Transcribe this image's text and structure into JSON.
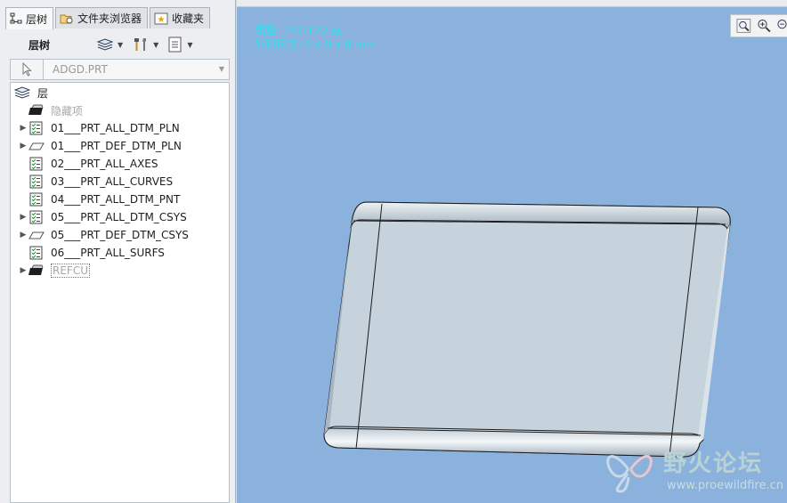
{
  "tabs": [
    {
      "label": "层树",
      "icon": "layer-tree-icon"
    },
    {
      "label": "文件夹浏览器",
      "icon": "folder-browser-icon"
    },
    {
      "label": "收藏夹",
      "icon": "favorites-icon"
    }
  ],
  "toolbar": {
    "title": "层树"
  },
  "filter": {
    "value": "ADGD.PRT"
  },
  "tree": {
    "root_label": "层",
    "items": [
      {
        "label": "隐藏项",
        "expandable": false,
        "icon": "hidden-layer-icon",
        "style": "dim"
      },
      {
        "label": "01___PRT_ALL_DTM_PLN",
        "expandable": true,
        "icon": "layer-checklist-icon",
        "style": "normal"
      },
      {
        "label": "01___PRT_DEF_DTM_PLN",
        "expandable": true,
        "icon": "datum-plane-icon",
        "style": "normal"
      },
      {
        "label": "02___PRT_ALL_AXES",
        "expandable": false,
        "icon": "layer-checklist-icon",
        "style": "normal"
      },
      {
        "label": "03___PRT_ALL_CURVES",
        "expandable": false,
        "icon": "layer-checklist-icon",
        "style": "normal"
      },
      {
        "label": "04___PRT_ALL_DTM_PNT",
        "expandable": false,
        "icon": "layer-checklist-icon",
        "style": "normal"
      },
      {
        "label": "05___PRT_ALL_DTM_CSYS",
        "expandable": true,
        "icon": "layer-checklist-icon",
        "style": "normal"
      },
      {
        "label": "05___PRT_DEF_DTM_CSYS",
        "expandable": true,
        "icon": "datum-plane-icon",
        "style": "normal"
      },
      {
        "label": "06___PRT_ALL_SURFS",
        "expandable": false,
        "icon": "layer-checklist-icon",
        "style": "normal"
      },
      {
        "label": "REFCU",
        "expandable": true,
        "icon": "hidden-layer-icon",
        "style": "boxed"
      }
    ]
  },
  "viewport": {
    "info_line1": "质量: 237.120 克",
    "info_line2": "外形尺寸: 0 x 0 x 0 mm"
  },
  "watermark": {
    "name": "野火论坛",
    "url": "www.proewildfire.cn"
  }
}
